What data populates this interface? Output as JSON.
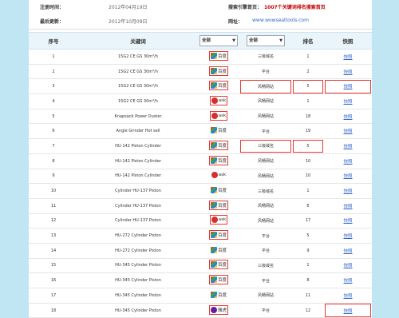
{
  "info": {
    "reg_label": "注册时间：",
    "reg_value": "2012年04月19日",
    "index_label": "搜索引擎首页：",
    "index_value": "1007个关键词排名搜索首页",
    "update_label": "最后更新：",
    "update_value": "2012年10月09日",
    "site_label": "网址：",
    "site_value": "www.wowsealtools.com"
  },
  "table": {
    "headers": [
      "序号",
      "关键词",
      "",
      "",
      "排名",
      "快照"
    ],
    "filter1": "全部",
    "filter2": "全部",
    "rows": [
      {
        "no": "1",
        "kw": "15G2 CE GS 30m³/h",
        "engine": "百度",
        "level": "三级域名",
        "rank": "1",
        "snap": "快照"
      },
      {
        "no": "2",
        "kw": "15G2 CE GS 30m³/h",
        "engine": "百度",
        "level": "平台",
        "rank": "2",
        "snap": "快照"
      },
      {
        "no": "3",
        "kw": "15G2 CE GS 30m³/h",
        "engine": "百度",
        "level": "风畅网站",
        "rank": "5",
        "snap": "快照"
      },
      {
        "no": "4",
        "kw": "15G2 CE GS 30m³/h",
        "engine": "ask",
        "level": "风畅网站",
        "rank": "1",
        "snap": "快照"
      },
      {
        "no": "5",
        "kw": "Knapsack Power Duster",
        "engine": "ask",
        "level": "风畅网站",
        "rank": "18",
        "snap": "快照"
      },
      {
        "no": "6",
        "kw": "Angle Grinder Hot sell",
        "engine": "百度",
        "level": "平台",
        "rank": "19",
        "snap": "快照"
      },
      {
        "no": "7",
        "kw": "HU-142 Piston Cylinder",
        "engine": "百度",
        "level": "三级域名",
        "rank": "5",
        "snap": "快照"
      },
      {
        "no": "8",
        "kw": "HU-142 Piston Cylinder",
        "engine": "百度",
        "level": "风畅网站",
        "rank": "10",
        "snap": "快照"
      },
      {
        "no": "9",
        "kw": "HU-142 Piston Cylinder",
        "engine": "ask",
        "level": "风畅网站",
        "rank": "10",
        "snap": "快照"
      },
      {
        "no": "10",
        "kw": "Cylinder HU-137 Piston",
        "engine": "百度",
        "level": "三级域名",
        "rank": "1",
        "snap": "快照"
      },
      {
        "no": "11",
        "kw": "Cylinder HU-137 Piston",
        "engine": "百度",
        "level": "风畅网站",
        "rank": "6",
        "snap": "快照"
      },
      {
        "no": "12",
        "kw": "Cylinder HU-137 Piston",
        "engine": "ask",
        "level": "风畅网站",
        "rank": "17",
        "snap": "快照"
      },
      {
        "no": "13",
        "kw": "HU-272 Cylinder Piston",
        "engine": "百度",
        "level": "平台",
        "rank": "5",
        "snap": "快照"
      },
      {
        "no": "14",
        "kw": "HU-272 Cylinder Piston",
        "engine": "百度",
        "level": "平台",
        "rank": "9",
        "snap": "快照"
      },
      {
        "no": "15",
        "kw": "HU-345 Cylinder Piston",
        "engine": "百度",
        "level": "三级域名",
        "rank": "1",
        "snap": "快照"
      },
      {
        "no": "16",
        "kw": "HU-345 Cylinder Piston",
        "engine": "百度",
        "level": "平台",
        "rank": "8",
        "snap": "快照"
      },
      {
        "no": "17",
        "kw": "HU-345 Cylinder Piston",
        "engine": "百度",
        "level": "风畅网站",
        "rank": "11",
        "snap": "快照"
      },
      {
        "no": "18",
        "kw": "HU-345 Cylinder Piston",
        "engine": "雅虎",
        "level": "平台",
        "rank": "12",
        "snap": "快照"
      }
    ]
  },
  "colors": {
    "accent": "#3366cc",
    "highlight": "#e53935"
  }
}
